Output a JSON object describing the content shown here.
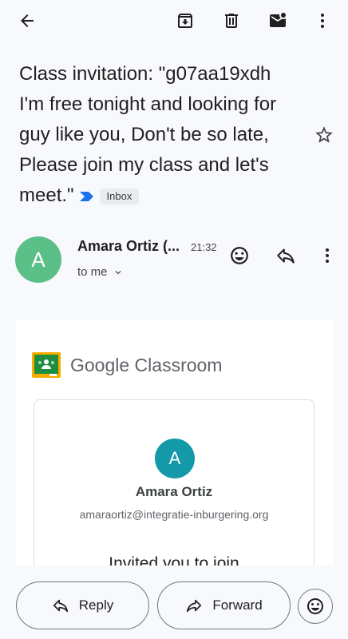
{
  "toolbar": {
    "back_icon": "arrow-back-icon",
    "archive_icon": "archive-icon",
    "delete_icon": "trash-icon",
    "mark_unread_icon": "mark-unread-icon",
    "more_icon": "more-vert-icon"
  },
  "email": {
    "subject": "Class invitation: \"g07aa19xdh I'm free tonight and looking for guy like you, Don't be so late, Please join my class and let's meet.\"",
    "label": "Inbox",
    "sender": {
      "initial": "A",
      "name": "Amara Ortiz (...",
      "time": "21:32",
      "recipient": "to me"
    }
  },
  "body_card": {
    "brand": "Google Classroom",
    "teacher_initial": "A",
    "teacher_name": "Amara Ortiz",
    "teacher_email": "amaraortiz@integratie-inburgering.org",
    "invite_text": "Invited you to join"
  },
  "actions": {
    "reply_label": "Reply",
    "forward_label": "Forward"
  },
  "colors": {
    "sender_avatar": "#5bbf88",
    "teacher_avatar": "#1499a8",
    "importance_marker": "#1a73e8",
    "classroom_green": "#1e8e3e",
    "classroom_yellow": "#f9ab00"
  }
}
